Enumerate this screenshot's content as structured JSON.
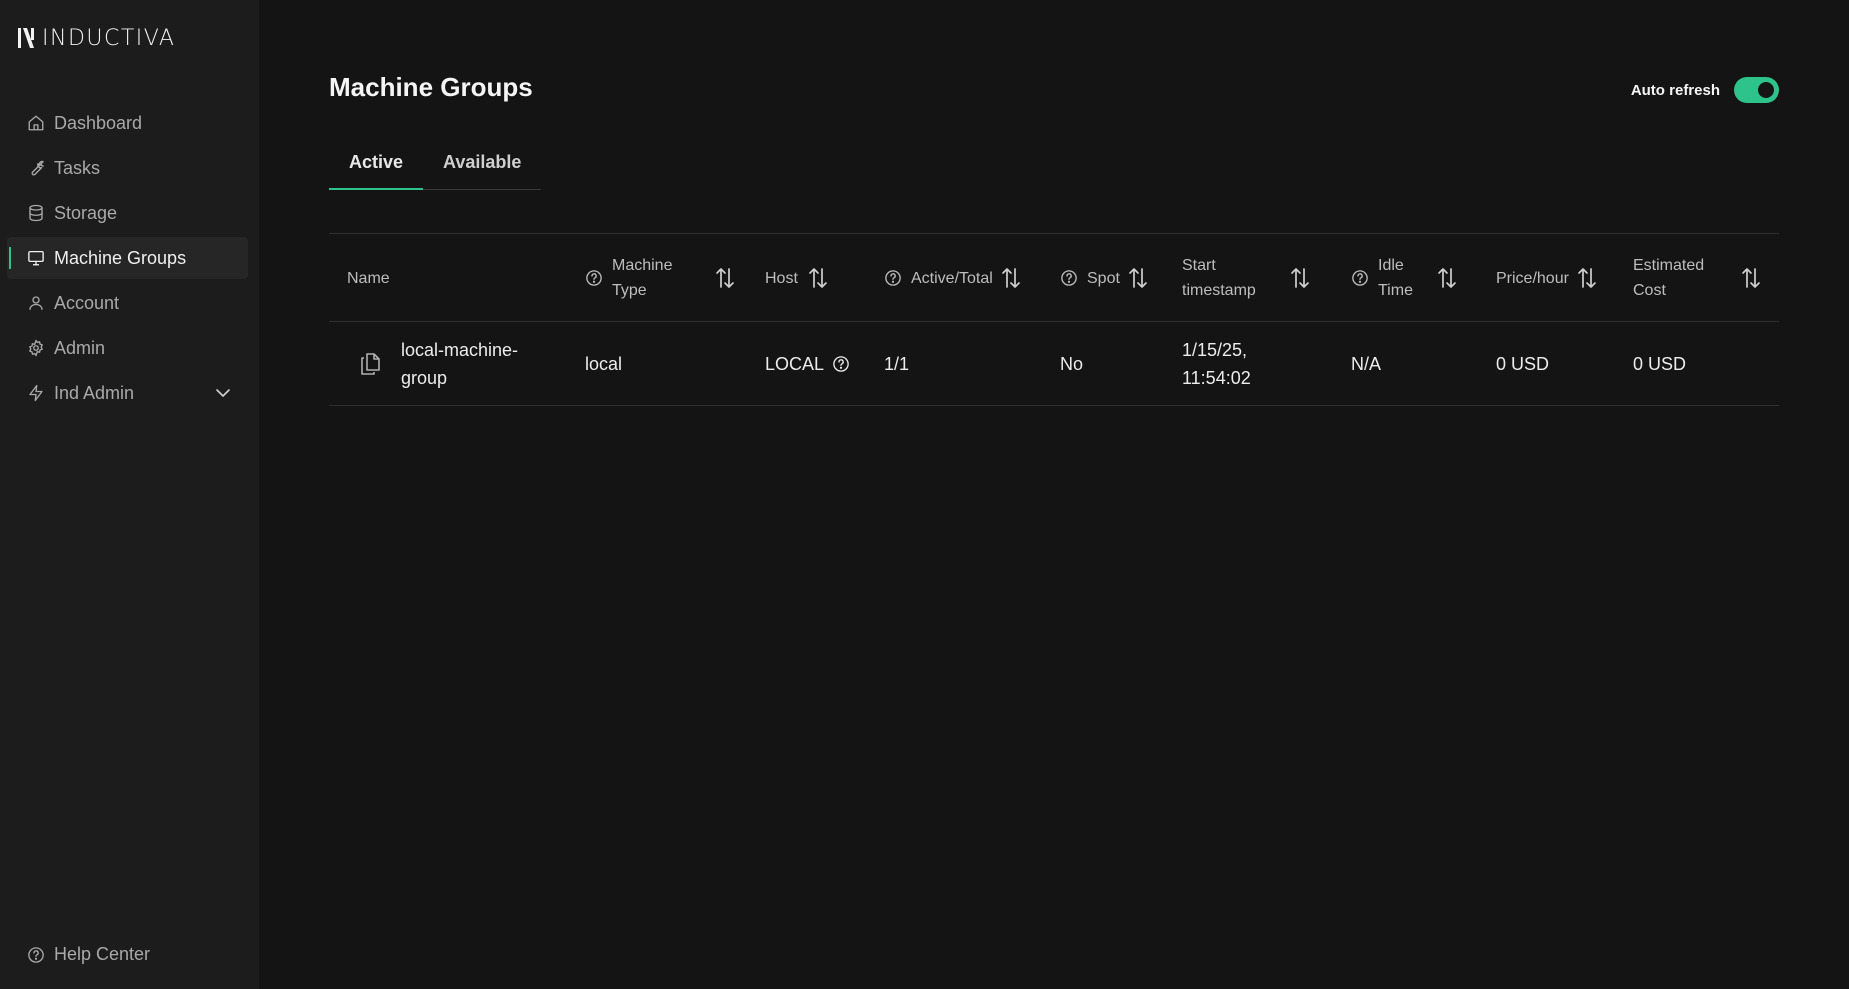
{
  "app": {
    "logo_text": "INDUCTIVA"
  },
  "sidebar": {
    "items": [
      {
        "label": "Dashboard",
        "icon": "home-icon"
      },
      {
        "label": "Tasks",
        "icon": "wrench-icon"
      },
      {
        "label": "Storage",
        "icon": "database-icon"
      },
      {
        "label": "Machine Groups",
        "icon": "monitor-icon",
        "active": true
      },
      {
        "label": "Account",
        "icon": "user-icon"
      },
      {
        "label": "Admin",
        "icon": "gear-icon"
      },
      {
        "label": "Ind Admin",
        "icon": "bolt-icon",
        "expandable": true
      }
    ],
    "help_label": "Help Center"
  },
  "header": {
    "title": "Machine Groups",
    "auto_refresh_label": "Auto refresh",
    "auto_refresh_on": true
  },
  "tabs": [
    {
      "label": "Active",
      "active": true
    },
    {
      "label": "Available",
      "active": false
    }
  ],
  "table": {
    "columns": [
      {
        "label": "Name",
        "help": false,
        "sortable": false
      },
      {
        "label": "Machine Type",
        "help": true,
        "sortable": true
      },
      {
        "label": "Host",
        "help": false,
        "sortable": true
      },
      {
        "label": "Active/Total",
        "help": true,
        "sortable": true
      },
      {
        "label": "Spot",
        "help": true,
        "sortable": true
      },
      {
        "label": "Start timestamp",
        "help": false,
        "sortable": true
      },
      {
        "label": "Idle Time",
        "help": true,
        "sortable": true
      },
      {
        "label": "Price/hour",
        "help": false,
        "sortable": true
      },
      {
        "label": "Estimated Cost",
        "help": false,
        "sortable": true
      }
    ],
    "rows": [
      {
        "name": "local-machine-group",
        "machine_type": "local",
        "host": "LOCAL",
        "active_total": "1/1",
        "spot": "No",
        "start_timestamp": "1/15/25, 11:54:02",
        "idle_time": "N/A",
        "price_hour": "0 USD",
        "estimated_cost": "0 USD"
      }
    ]
  },
  "colors": {
    "accent": "#2ec38a",
    "background": "#141414",
    "sidebar": "#1c1c1c"
  }
}
